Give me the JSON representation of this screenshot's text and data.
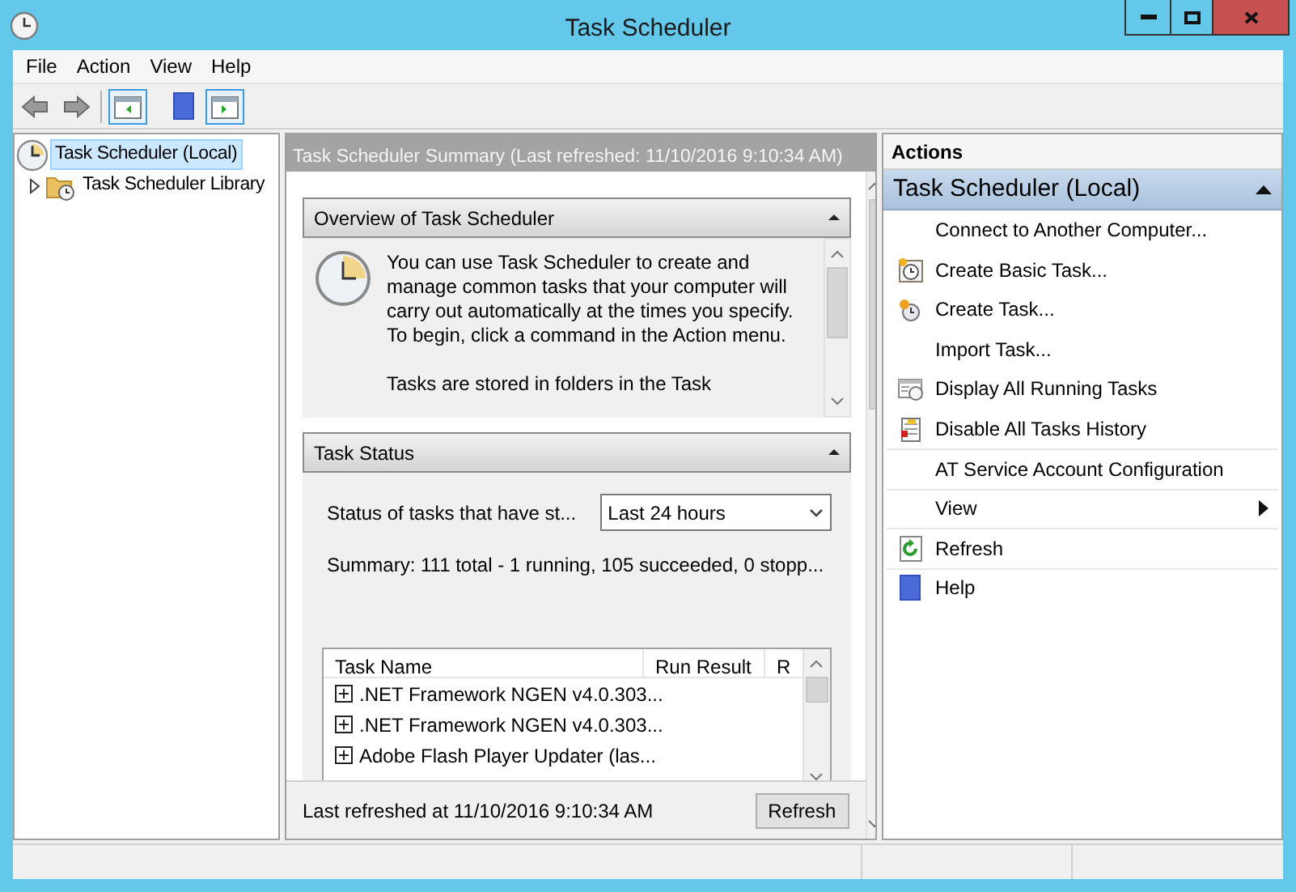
{
  "window": {
    "title": "Task Scheduler"
  },
  "menu": [
    "File",
    "Action",
    "View",
    "Help"
  ],
  "tree": [
    {
      "label": "Task Scheduler (Local)",
      "selected": true,
      "children": [
        {
          "label": "Task Scheduler Library",
          "selected": false,
          "expanded": false
        }
      ]
    }
  ],
  "summary": {
    "header": "Task Scheduler Summary (Last refreshed: 11/10/2016 9:10:34 AM)",
    "overview": {
      "title": "Overview of Task Scheduler",
      "expanded": true,
      "paragraphs": [
        "You can use Task Scheduler to create and manage common tasks that your computer will carry out automatically at the times you specify. To begin, click a command in the Action menu.",
        "Tasks are stored in folders in the Task"
      ]
    },
    "task_status": {
      "title": "Task Status",
      "expanded": true,
      "filter_label": "Status of tasks that have st...",
      "filter_value": "Last 24 hours",
      "summary": "Summary: 111 total - 1 running, 105 succeeded, 0 stopp...",
      "table": {
        "columns": [
          "Task Name",
          "Run Result",
          "R"
        ],
        "rows": [
          {
            "name": ".NET Framework NGEN v4.0.303...",
            "expanded": false
          },
          {
            "name": ".NET Framework NGEN v4.0.303...",
            "expanded": false
          },
          {
            "name": "Adobe Flash Player Updater (las...",
            "expanded": false
          }
        ]
      }
    },
    "footer": "Last refreshed at 11/10/2016 9:10:34 AM",
    "refresh_button": "Refresh"
  },
  "actions": {
    "title": "Actions",
    "group": "Task Scheduler (Local)",
    "expanded": true,
    "items": [
      {
        "label": "Connect to Another Computer...",
        "kind": "plain",
        "separated": false
      },
      {
        "label": "Create Basic Task...",
        "kind": "basic-task",
        "separated": false
      },
      {
        "label": "Create Task...",
        "kind": "task",
        "separated": false
      },
      {
        "label": "Import Task...",
        "kind": "plain",
        "separated": false
      },
      {
        "label": "Display All Running Tasks",
        "kind": "running",
        "separated": false
      },
      {
        "label": "Disable All Tasks History",
        "kind": "history",
        "separated": false
      },
      {
        "label": "AT Service Account Configuration",
        "kind": "plain",
        "separated": true
      },
      {
        "label": "View",
        "kind": "submenu",
        "separated": true
      },
      {
        "label": "Refresh",
        "kind": "refresh",
        "separated": true
      },
      {
        "label": "Help",
        "kind": "help",
        "separated": true
      }
    ]
  }
}
